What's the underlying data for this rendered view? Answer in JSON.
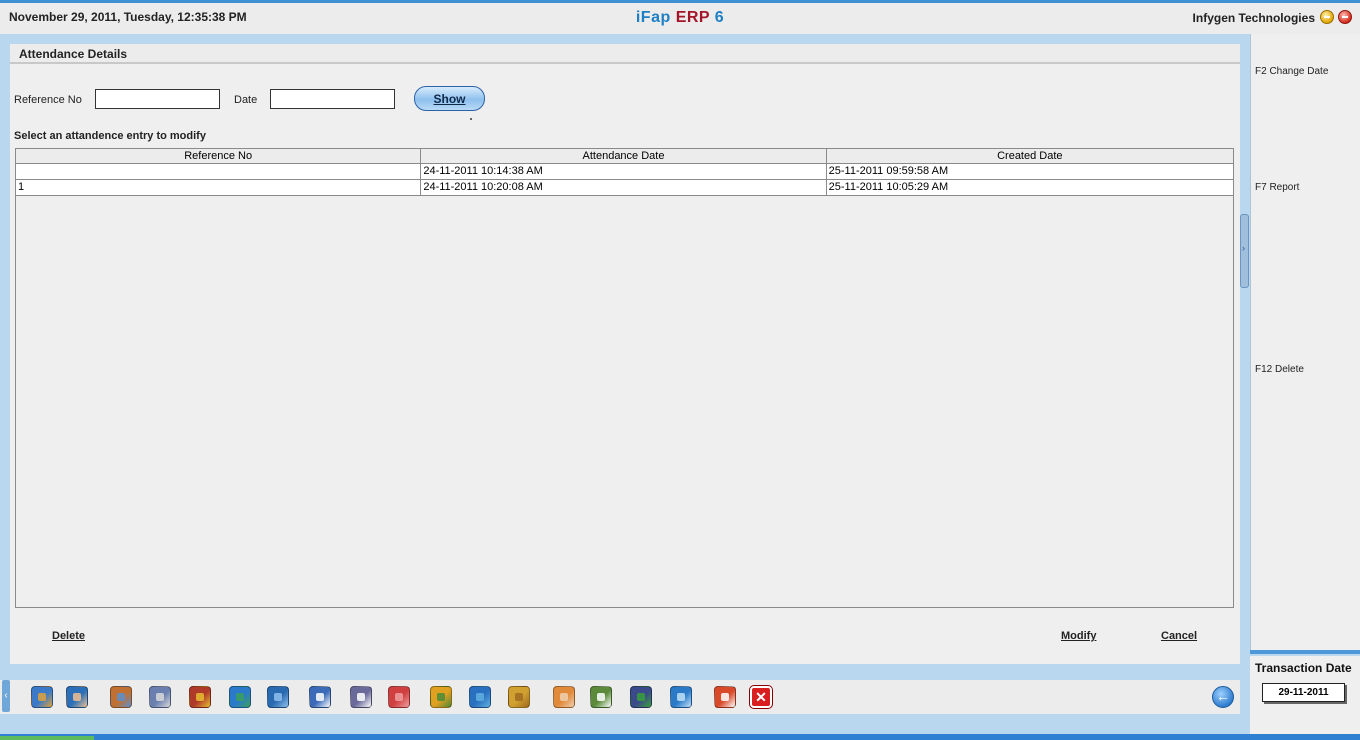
{
  "topbar": {
    "datetime": "November  29, 2011, Tuesday, 12:35:38 PM",
    "brand_1": "iFap",
    "brand_2": "ERP",
    "brand_3": "6",
    "company": "Infygen Technologies"
  },
  "main": {
    "title": "Attendance Details",
    "ref_label": "Reference No",
    "ref_value": "",
    "date_label": "Date",
    "date_value": "",
    "show_label": "Show",
    "instruction": "Select an attandence entry to modify",
    "table": {
      "headers": [
        "Reference No",
        "Attendance Date",
        "Created Date"
      ],
      "rows": [
        [
          "",
          "24-11-2011 10:14:38 AM",
          "25-11-2011 09:59:58 AM"
        ],
        [
          "1",
          "24-11-2011 10:20:08 AM",
          "25-11-2011 10:05:29 AM"
        ]
      ]
    },
    "delete_label": "Delete",
    "modify_label": "Modify",
    "cancel_label": "Cancel"
  },
  "right_panel": {
    "f2": "F2 Change Date",
    "f7": "F7 Report",
    "f12": "F12 Delete"
  },
  "transaction": {
    "label": "Transaction Date",
    "value": "29-11-2011"
  },
  "dock": {
    "icons": [
      {
        "name": "ledger-icon",
        "color": "#3a7ac8",
        "accent": "#e0a23a"
      },
      {
        "name": "user-search-icon",
        "color": "#2a6fb8",
        "accent": "#f0c090"
      },
      {
        "name": "employees-icon",
        "color": "#c07030",
        "accent": "#5a8fd0"
      },
      {
        "name": "network-icon",
        "color": "#6a7fb0",
        "accent": "#d9d9d9"
      },
      {
        "name": "books-icon",
        "color": "#b03a2a",
        "accent": "#e8c030"
      },
      {
        "name": "cart-icon",
        "color": "#2a7acc",
        "accent": "#3aa05a"
      },
      {
        "name": "sync-icon",
        "color": "#2a6ab0",
        "accent": "#8fc0ee"
      },
      {
        "name": "window-icon",
        "color": "#3a6ab8",
        "accent": "#ffffff"
      },
      {
        "name": "document-icon",
        "color": "#6a6a9a",
        "accent": "#ffffff"
      },
      {
        "name": "chart-icon",
        "color": "#d04040",
        "accent": "#f0a0a0"
      },
      {
        "name": "tree-icon",
        "color": "#e0a020",
        "accent": "#4a8a3a"
      },
      {
        "name": "share-icon",
        "color": "#2a70c0",
        "accent": "#60b0e0"
      },
      {
        "name": "package-icon",
        "color": "#d0a030",
        "accent": "#a06a20"
      },
      {
        "name": "dial-icon",
        "color": "#e08a3a",
        "accent": "#f0d0b0"
      },
      {
        "name": "spreadsheet-icon",
        "color": "#5a8a3a",
        "accent": "#ffffff"
      },
      {
        "name": "save-icon",
        "color": "#3a4a8a",
        "accent": "#3aa03a"
      },
      {
        "name": "settings-icon",
        "color": "#2a7ac8",
        "accent": "#bfe0f8"
      },
      {
        "name": "calendar-icon",
        "color": "#d84a2a",
        "accent": "#ffffff"
      },
      {
        "name": "close-icon",
        "color": "#d81e1e",
        "accent": "#ffffff"
      }
    ]
  }
}
